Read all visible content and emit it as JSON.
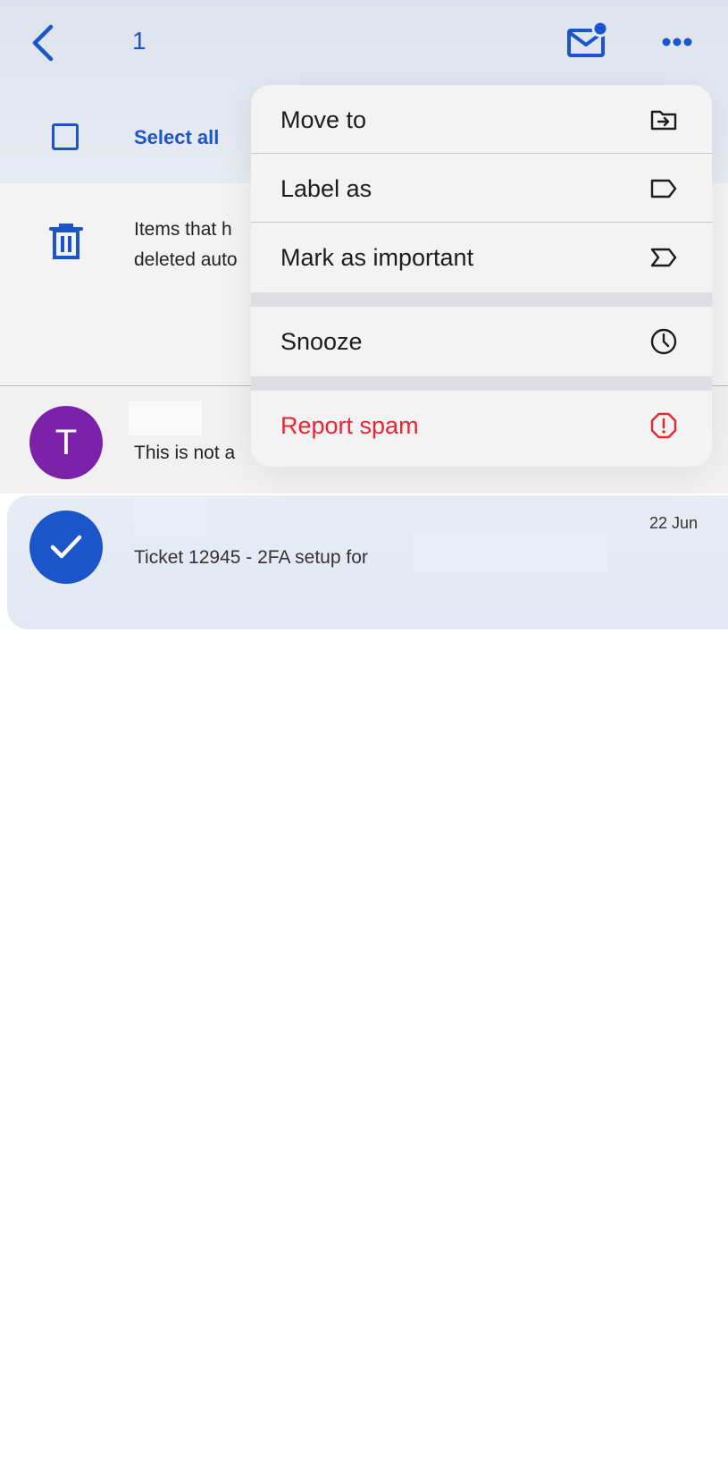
{
  "header": {
    "selected_count": "1",
    "select_all_label": "Select all"
  },
  "banner": {
    "text_line1": "Items that h",
    "text_line2": "deleted auto"
  },
  "emails": [
    {
      "avatar_letter": "T",
      "snippet": "This is not a",
      "avatar_color": "#7b22a8"
    },
    {
      "date": "22 Jun",
      "snippet": "Ticket 12945 - 2FA setup for",
      "selected": true
    }
  ],
  "menu": {
    "items": [
      {
        "label": "Move to",
        "icon": "move-to-folder-icon"
      },
      {
        "label": "Label as",
        "icon": "label-icon"
      },
      {
        "label": "Mark as important",
        "icon": "important-icon"
      },
      {
        "label": "Snooze",
        "icon": "clock-icon"
      },
      {
        "label": "Report spam",
        "icon": "report-spam-icon",
        "color": "#e8262f"
      }
    ]
  },
  "colors": {
    "accent": "#1a56c9",
    "danger": "#e8262f"
  }
}
